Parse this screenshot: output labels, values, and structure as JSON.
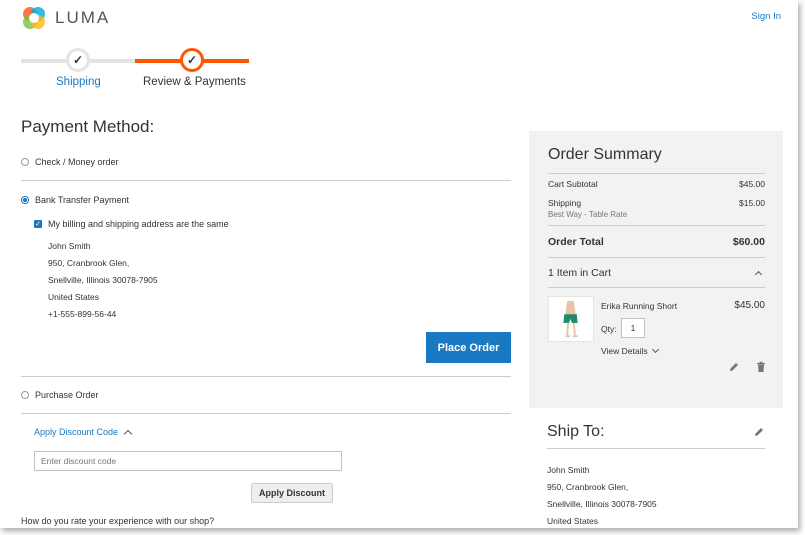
{
  "header": {
    "logo_text": "LUMA",
    "sign_in": "Sign In"
  },
  "progress": {
    "steps": [
      {
        "label": "Shipping",
        "state": "complete"
      },
      {
        "label": "Review & Payments",
        "state": "active"
      }
    ],
    "check_glyph": "✓"
  },
  "payment": {
    "title": "Payment Method:",
    "methods": [
      {
        "label": "Check / Money order",
        "selected": false
      },
      {
        "label": "Bank Transfer Payment",
        "selected": true
      },
      {
        "label": "Purchase Order",
        "selected": false
      }
    ],
    "same_address_label": "My billing and shipping address are the same",
    "same_address_checked": true,
    "billing_address": {
      "name": "John Smith",
      "street": "950, Cranbrook Glen,",
      "city_line": "Snellville, Illinois 30078-7905",
      "country": "United States",
      "phone": "+1-555-899-56-44"
    },
    "place_order_label": "Place Order"
  },
  "discount": {
    "toggle_label": "Apply Discount Code",
    "input_placeholder": "Enter discount code",
    "apply_label": "Apply Discount"
  },
  "rating_question": "How do you rate your experience with our shop?",
  "summary": {
    "title": "Order Summary",
    "cart_subtotal_label": "Cart Subtotal",
    "cart_subtotal_value": "$45.00",
    "shipping_label": "Shipping",
    "shipping_value": "$15.00",
    "shipping_method": "Best Way - Table Rate",
    "order_total_label": "Order Total",
    "order_total_value": "$60.00",
    "items_label": "1 Item in Cart",
    "item": {
      "name": "Erika Running Short",
      "price": "$45.00",
      "qty_label": "Qty:",
      "qty": "1",
      "view_details": "View Details"
    }
  },
  "ship_to": {
    "title": "Ship To:",
    "name": "John Smith",
    "street": "950, Cranbrook Glen,",
    "city_line": "Snellville, Illinois 30078-7905",
    "country": "United States"
  },
  "colors": {
    "accent_blue": "#1979c3",
    "progress_orange": "#ff5501",
    "summary_bg": "#f2f2f2"
  },
  "icons": [
    "luma-logo-icon",
    "check-icon",
    "chevron-up-icon",
    "chevron-down-icon",
    "pencil-edit-icon",
    "trash-icon"
  ]
}
